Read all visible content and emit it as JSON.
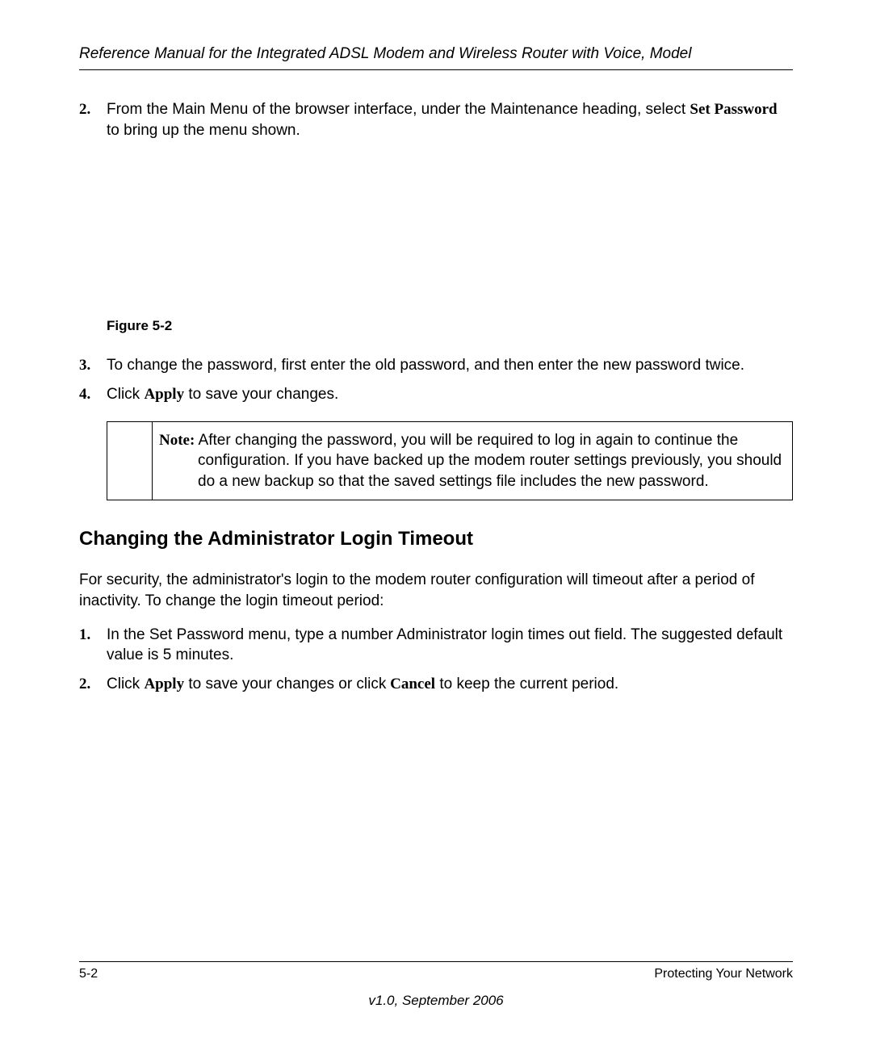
{
  "header": {
    "title": "Reference Manual for the Integrated ADSL Modem and Wireless Router with Voice, Model"
  },
  "steps1": {
    "item2": {
      "num": "2.",
      "text_a": "From the Main Menu of the browser interface, under the Maintenance heading",
      "text_b": ", select ",
      "bold_a": "Set Password",
      "text_c": " to bring up the menu shown."
    },
    "figure_caption": "Figure 5-2",
    "item3": {
      "num": "3.",
      "text_a": "To change the password, first enter the old",
      "text_b": " password, and then enter the new password twice."
    },
    "item4": {
      "num": "4.",
      "text_a": "Click ",
      "bold_a": "Apply",
      "text_b": " to save your changes."
    }
  },
  "note": {
    "label": "Note:",
    "text_a": " After changing the password, you will be",
    "text_b": " required to log in",
    "text_c": " again to continue the configuration. If you have backed up the modem router settings previously, you should do a new backup so that",
    "text_d": " the saved settings file includes the new password."
  },
  "section_heading": "Changing the Administrator Login Timeout",
  "para1": {
    "text_a": "For security, the administrator's login to the",
    "text_b": " modem router configuration",
    "text_c": " will timeout after a period of inactivity. To cha",
    "text_d": "nge the login timeout period:"
  },
  "steps2": {
    "item1": {
      "num": "1.",
      "text_a": "In the Set Password menu, type a number",
      "text_b": " Administrator login times out  field. The suggested default value is 5 minutes."
    },
    "item2": {
      "num": "2.",
      "text_a": "Click ",
      "bold_a": "Apply",
      "text_b": " to save your changes or click",
      "bold_b": " Cancel",
      "text_c": " to keep the current period."
    }
  },
  "footer": {
    "left": "5-2",
    "right": "Protecting Your Network",
    "version": "v1.0, September 2006"
  }
}
